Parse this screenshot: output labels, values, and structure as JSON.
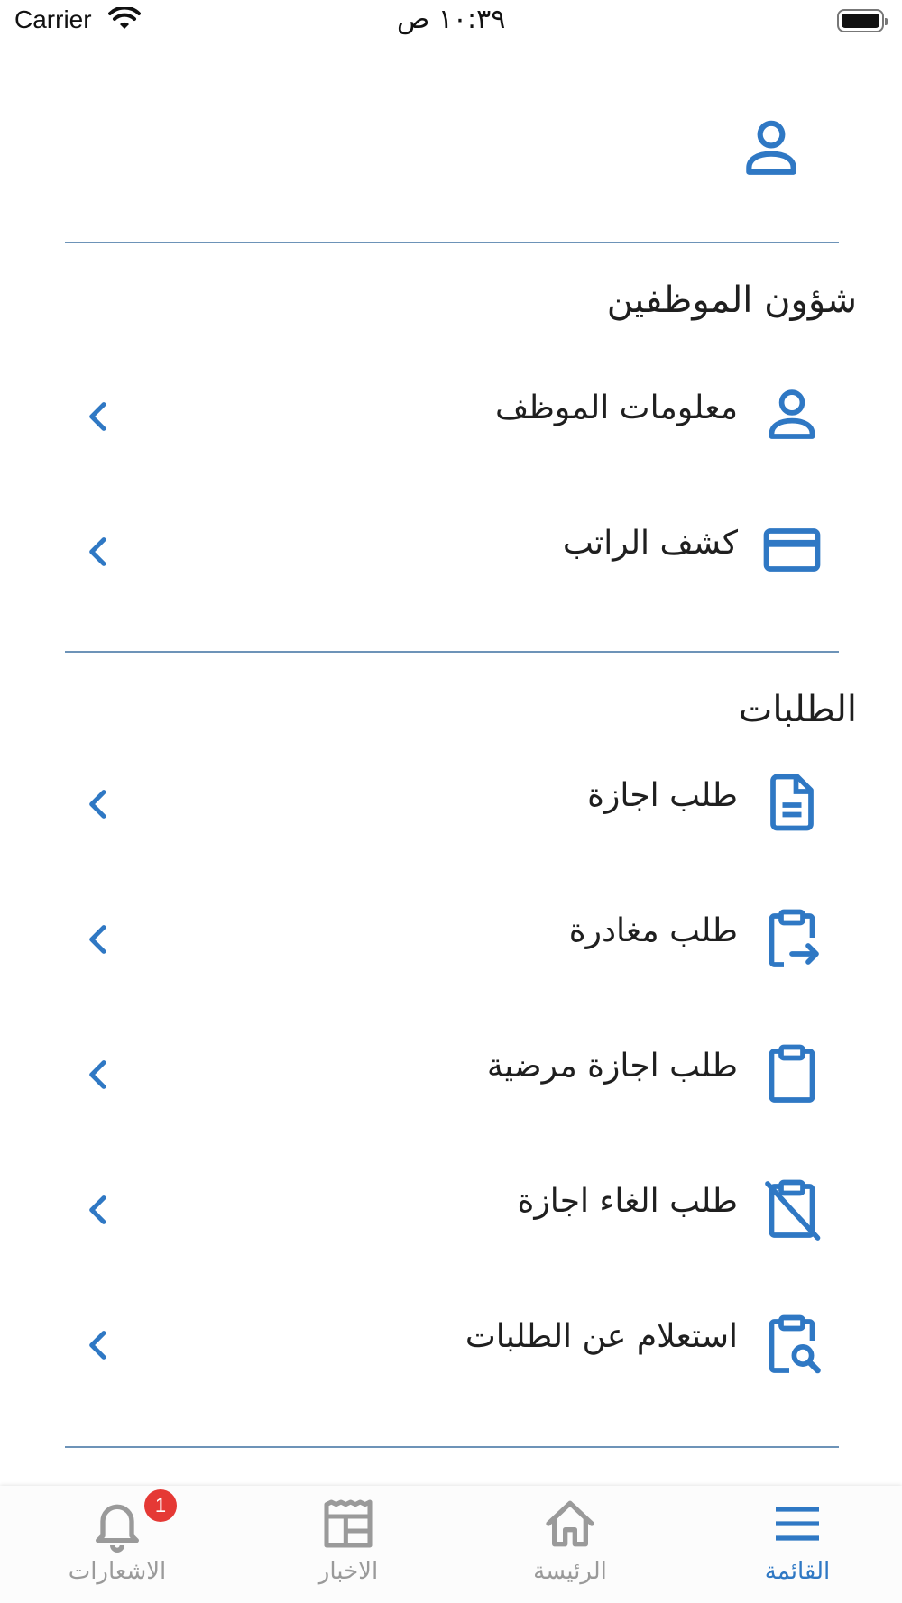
{
  "status_bar": {
    "carrier": "Carrier",
    "time": "١٠:٣٩ ص"
  },
  "colors": {
    "accent": "#2f78c4",
    "divider": "#6d93b8",
    "inactive": "#9a9a9a",
    "badge": "#e53935"
  },
  "profile": {
    "icon": "user-icon"
  },
  "sections": [
    {
      "title": "شؤون الموظفين",
      "items": [
        {
          "label": "معلومات الموظف",
          "icon": "user-icon"
        },
        {
          "label": "كشف الراتب",
          "icon": "credit-card-icon"
        }
      ]
    },
    {
      "title": "الطلبات",
      "items": [
        {
          "label": "طلب اجازة",
          "icon": "document-icon"
        },
        {
          "label": "طلب مغادرة",
          "icon": "clipboard-arrow-icon"
        },
        {
          "label": "طلب اجازة مرضية",
          "icon": "clipboard-icon"
        },
        {
          "label": "طلب الغاء اجازة",
          "icon": "clipboard-off-icon"
        },
        {
          "label": "استعلام عن الطلبات",
          "icon": "clipboard-search-icon"
        }
      ]
    }
  ],
  "tabbar": {
    "tabs": [
      {
        "label": "القائمة",
        "icon": "menu-icon",
        "active": true
      },
      {
        "label": "الرئيسة",
        "icon": "home-icon",
        "active": false
      },
      {
        "label": "الاخبار",
        "icon": "news-icon",
        "active": false
      },
      {
        "label": "الاشعارات",
        "icon": "bell-icon",
        "active": false,
        "badge": "1"
      }
    ]
  }
}
